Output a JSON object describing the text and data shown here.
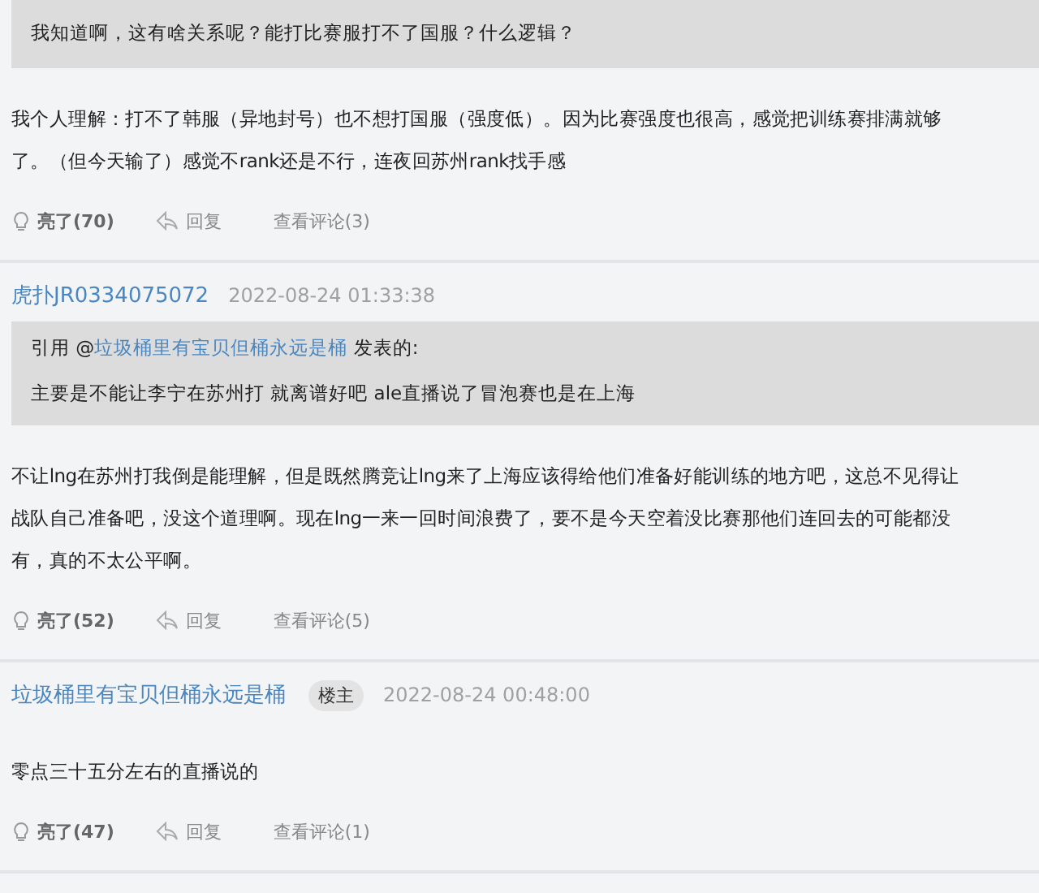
{
  "posts": [
    {
      "quote": {
        "text": "我知道啊，这有啥关系呢？能打比赛服打不了国服？什么逻辑？"
      },
      "body": "我个人理解：打不了韩服（异地封号）也不想打国服（强度低）。因为比赛强度也很高，感觉把训练赛排满就够了。（但今天输了）感觉不rank还是不行，连夜回苏州rank找手感",
      "actions": {
        "like": "亮了(70)",
        "reply": "回复",
        "comments": "查看评论(3)"
      }
    },
    {
      "author": "虎扑JR0334075072",
      "time": "2022-08-24 01:33:38",
      "quote": {
        "prefix": "引用 @",
        "user": "垃圾桶里有宝贝但桶永远是桶",
        "suffix": "发表的:",
        "text": "主要是不能让李宁在苏州打 就离谱好吧 ale直播说了冒泡赛也是在上海"
      },
      "body": "不让lng在苏州打我倒是能理解，但是既然腾竞让lng来了上海应该得给他们准备好能训练的地方吧，这总不见得让战队自己准备吧，没这个道理啊。现在lng一来一回时间浪费了，要不是今天空着没比赛那他们连回去的可能都没有，真的不太公平啊。",
      "actions": {
        "like": "亮了(52)",
        "reply": "回复",
        "comments": "查看评论(5)"
      }
    },
    {
      "author": "垃圾桶里有宝贝但桶永远是桶",
      "badge": "楼主",
      "time": "2022-08-24 00:48:00",
      "body": "零点三十五分左右的直播说的",
      "actions": {
        "like": "亮了(47)",
        "reply": "回复",
        "comments": "查看评论(1)"
      }
    }
  ]
}
